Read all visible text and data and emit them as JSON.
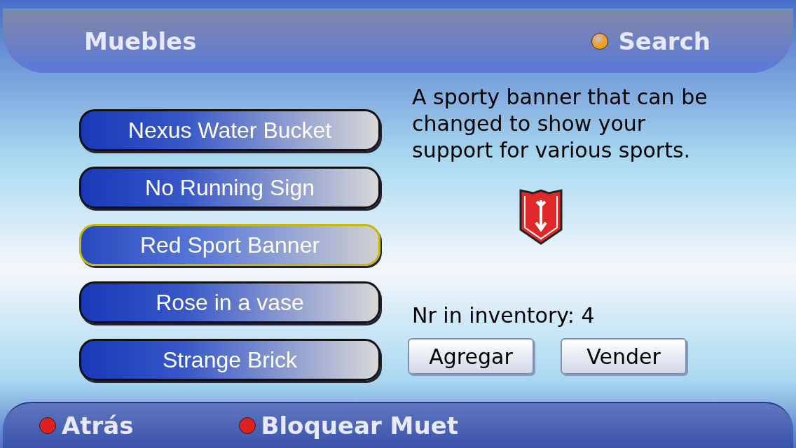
{
  "header": {
    "title": "Muebles",
    "action": {
      "label": "Search",
      "color": "#f0a020"
    }
  },
  "items": [
    {
      "label": "Nexus Water Bucket",
      "selected": false
    },
    {
      "label": "No Running Sign",
      "selected": false
    },
    {
      "label": "Red Sport Banner",
      "selected": true
    },
    {
      "label": "Rose in a vase",
      "selected": false
    },
    {
      "label": "Strange Brick",
      "selected": false
    }
  ],
  "detail": {
    "description": "A sporty banner that can be changed to show your support for various sports.",
    "inventory": "Nr in inventory: 4",
    "buttons": [
      "Agregar",
      "Vender"
    ]
  },
  "footer": [
    {
      "label": "Atrás",
      "color": "#e02020"
    },
    {
      "label": "Bloquear Muet",
      "color": "#e02020"
    }
  ]
}
